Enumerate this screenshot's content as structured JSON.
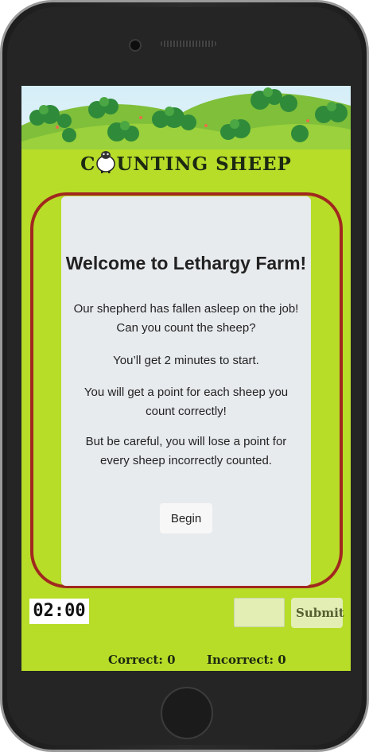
{
  "app": {
    "title": "COUNTING SHEEP",
    "title_before_icon": "C",
    "title_after_icon": "UNTING SHEEP"
  },
  "card": {
    "heading": "Welcome to Lethargy Farm!",
    "paragraphs": [
      "Our shepherd has fallen asleep on the job! Can you count the sheep?",
      "You’ll get 2 minutes to start.",
      "You will get a point for each sheep you count correctly!",
      "But be careful, you will lose a point for every sheep incorrectly counted."
    ],
    "begin_label": "Begin"
  },
  "controls": {
    "timer": "02:00",
    "answer_value": "",
    "submit_label": "Submit"
  },
  "score": {
    "correct_label": "Correct: 0",
    "incorrect_label": "Incorrect: 0"
  },
  "colors": {
    "grass": "#b7dd28",
    "frame": "#a1281f",
    "card": "#e8ebee",
    "submit": "#e2eeb4"
  },
  "icons": {
    "title_sheep": "sheep-icon"
  }
}
